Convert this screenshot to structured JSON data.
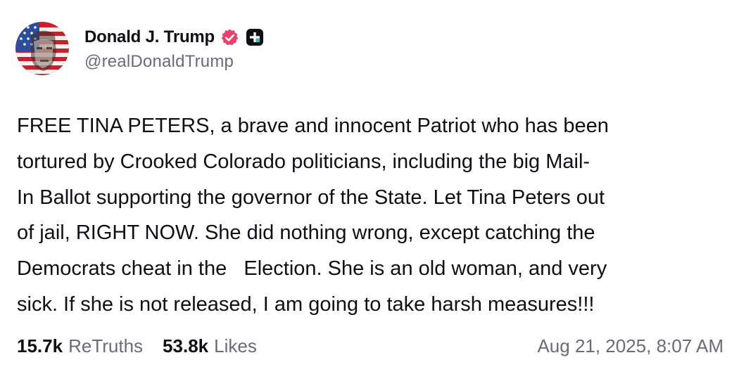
{
  "post": {
    "author": {
      "display_name": "Donald J. Trump",
      "handle": "@realDonaldTrump",
      "verified_icon": "verified-badge-icon",
      "extra_icon": "plus-icon"
    },
    "text": "FREE TINA PETERS, a brave and innocent Patriot who has been\ntortured by Crooked Colorado politicians, including the big Mail-\nIn Ballot supporting the governor of the State. Let Tina Peters out\nof jail, RIGHT NOW. She did nothing wrong, except catching the\nDemocrats cheat in the   Election. She is an old woman, and very\nsick. If she is not released, I am going to take harsh measures!!!",
    "stats": {
      "retruths_count": "15.7k",
      "retruths_label": "ReTruths",
      "likes_count": "53.8k",
      "likes_label": "Likes"
    },
    "timestamp": "Aug 21, 2025, 8:07 AM"
  },
  "colors": {
    "text": "#0f0f14",
    "muted": "#6b6b78",
    "verified_badge": "#e8436f",
    "plus_badge": "#0f0f14"
  }
}
